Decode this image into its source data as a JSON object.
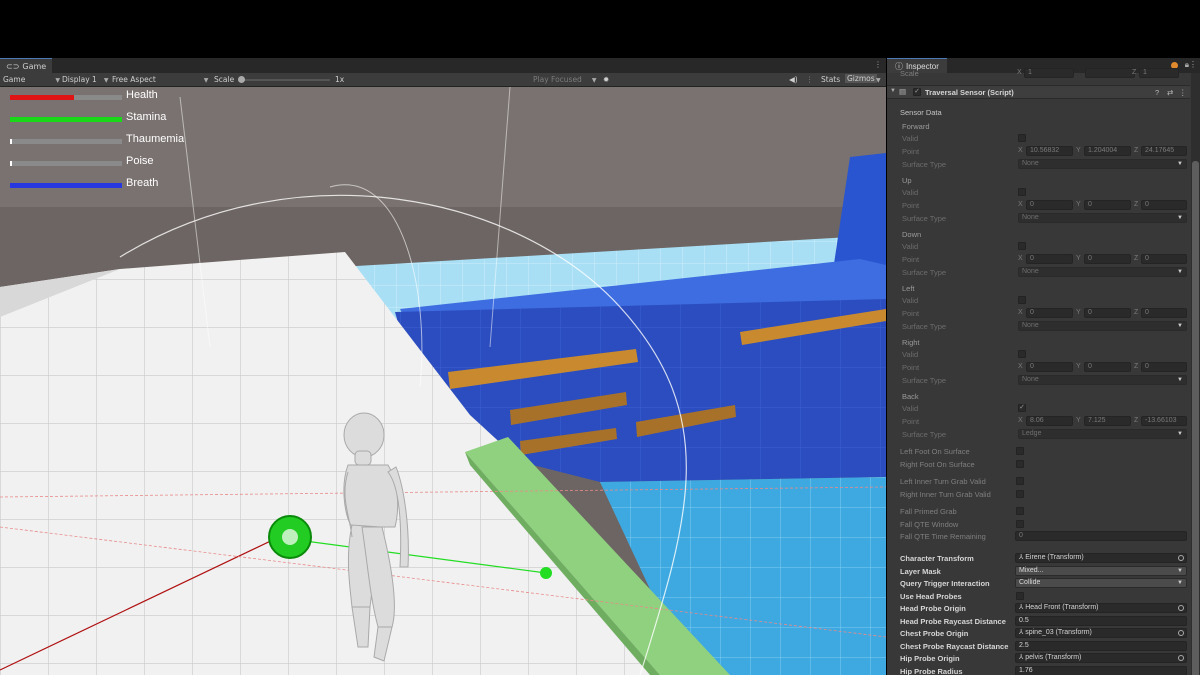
{
  "game_panel": {
    "tab_label": "Game",
    "toolbar": {
      "display_mode": "Game",
      "display": "Display 1",
      "aspect": "Free Aspect",
      "scale_label": "Scale",
      "scale_value": "1x",
      "play_mode": "Play Focused",
      "stats": "Stats",
      "gizmos": "Gizmos"
    },
    "hud": [
      {
        "label": "Health",
        "fill": 0.57,
        "color": "#e01414"
      },
      {
        "label": "Stamina",
        "fill": 1.0,
        "color": "#18d818"
      },
      {
        "label": "Thaumemia",
        "fill": 0.01,
        "color": "#ffffff"
      },
      {
        "label": "Poise",
        "fill": 0.01,
        "color": "#ffffff"
      },
      {
        "label": "Breath",
        "fill": 1.0,
        "color": "#2838e0"
      }
    ]
  },
  "inspector": {
    "tab_label": "Inspector",
    "prev_row": {
      "label": "Scale",
      "x": "1",
      "z": "1"
    },
    "component_title": "Traversal Sensor (Script)",
    "section_title": "Sensor Data",
    "directions": [
      {
        "name": "Forward",
        "valid_label": "Valid",
        "valid": false,
        "point_label": "Point",
        "x": "10.56832",
        "y": "1.204004",
        "z": "24.17645",
        "surface_label": "Surface Type",
        "surface": "None"
      },
      {
        "name": "Up",
        "valid_label": "Valid",
        "valid": false,
        "point_label": "Point",
        "x": "0",
        "y": "0",
        "z": "0",
        "surface_label": "Surface Type",
        "surface": "None"
      },
      {
        "name": "Down",
        "valid_label": "Valid",
        "valid": false,
        "point_label": "Point",
        "x": "0",
        "y": "0",
        "z": "0",
        "surface_label": "Surface Type",
        "surface": "None"
      },
      {
        "name": "Left",
        "valid_label": "Valid",
        "valid": false,
        "point_label": "Point",
        "x": "0",
        "y": "0",
        "z": "0",
        "surface_label": "Surface Type",
        "surface": "None"
      },
      {
        "name": "Right",
        "valid_label": "Valid",
        "valid": false,
        "point_label": "Point",
        "x": "0",
        "y": "0",
        "z": "0",
        "surface_label": "Surface Type",
        "surface": "None"
      },
      {
        "name": "Back",
        "valid_label": "Valid",
        "valid": true,
        "point_label": "Point",
        "x": "8.06",
        "y": "7.125",
        "z": "-13.66103",
        "surface_label": "Surface Type",
        "surface": "Ledge"
      }
    ],
    "flags": [
      {
        "label": "Left Foot On Surface",
        "checked": false
      },
      {
        "label": "Right Foot On Surface",
        "checked": false
      },
      {
        "label": "Left Inner Turn Grab Valid",
        "checked": false
      },
      {
        "label": "Right Inner Turn Grab Valid",
        "checked": false
      },
      {
        "label": "Fall Primed Grab",
        "checked": false
      },
      {
        "label": "Fall QTE Window",
        "checked": false
      }
    ],
    "fall_qte_time": {
      "label": "Fall QTE Time Remaining",
      "value": "0"
    },
    "props": [
      {
        "label": "Character Transform",
        "value": "Eirene (Transform)",
        "kind": "object"
      },
      {
        "label": "Layer Mask",
        "value": "Mixed...",
        "kind": "dropdown"
      },
      {
        "label": "Query Trigger Interaction",
        "value": "Collide",
        "kind": "dropdown"
      },
      {
        "label": "Use Head Probes",
        "value": "",
        "kind": "checkbox"
      },
      {
        "label": "Head Probe Origin",
        "value": "Head Front (Transform)",
        "kind": "object"
      },
      {
        "label": "Head Probe Raycast Distance",
        "value": "0.5",
        "kind": "number"
      },
      {
        "label": "Chest Probe Origin",
        "value": "spine_03 (Transform)",
        "kind": "object"
      },
      {
        "label": "Chest Probe Raycast Distance",
        "value": "2.5",
        "kind": "number"
      },
      {
        "label": "Hip Probe Origin",
        "value": "pelvis (Transform)",
        "kind": "object"
      },
      {
        "label": "Hip Probe Radius",
        "value": "1.76",
        "kind": "number"
      }
    ]
  },
  "colors": {
    "editor_bg": "#383838",
    "tab_accent": "#4d7ab4",
    "water": "#35a9e6",
    "floor": "#efefef",
    "wall": "#2a4fc0",
    "ledge": "#c98a2f",
    "beam": "#8ccf7e"
  },
  "icons": [
    "gamepad-icon",
    "info-icon",
    "script-icon",
    "help-icon",
    "preset-icon",
    "more-icon",
    "lock-icon",
    "speaker-icon",
    "gear-icon"
  ]
}
